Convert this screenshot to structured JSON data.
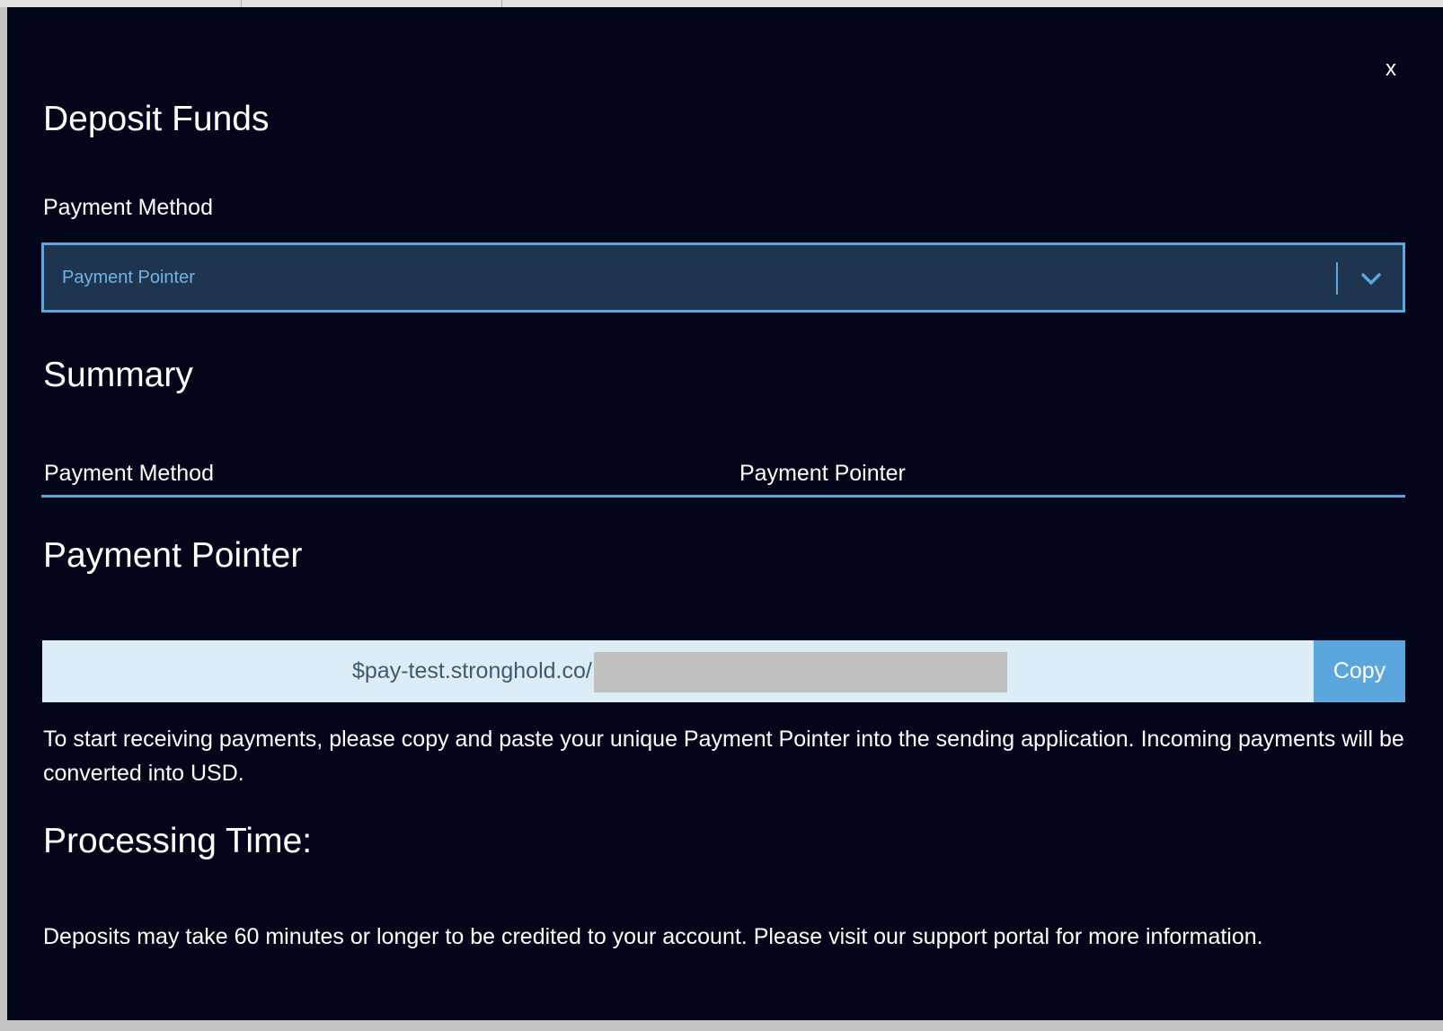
{
  "dialog": {
    "title": "Deposit Funds",
    "close_label": "x"
  },
  "payment_method": {
    "label": "Payment Method",
    "selected": "Payment Pointer"
  },
  "summary": {
    "heading": "Summary",
    "rows": [
      {
        "key": "Payment Method",
        "value": "Payment Pointer"
      }
    ]
  },
  "pointer": {
    "heading": "Payment Pointer",
    "value": "$pay-test.stronghold.co/",
    "copy_label": "Copy",
    "instructions": "To start receiving payments, please copy and paste your unique Payment Pointer into the sending application. Incoming payments will be converted into USD."
  },
  "processing": {
    "heading": "Processing Time:",
    "text": "Deposits may take 60 minutes or longer to be credited to your account. Please visit our support portal for more information."
  },
  "colors": {
    "modal_background": "#03051a",
    "accent": "#5aa6dd",
    "select_background": "#1f344f",
    "pointer_field_background": "#dcedf7"
  },
  "icons": {
    "close": "close-icon",
    "dropdown": "chevron-down-icon"
  }
}
